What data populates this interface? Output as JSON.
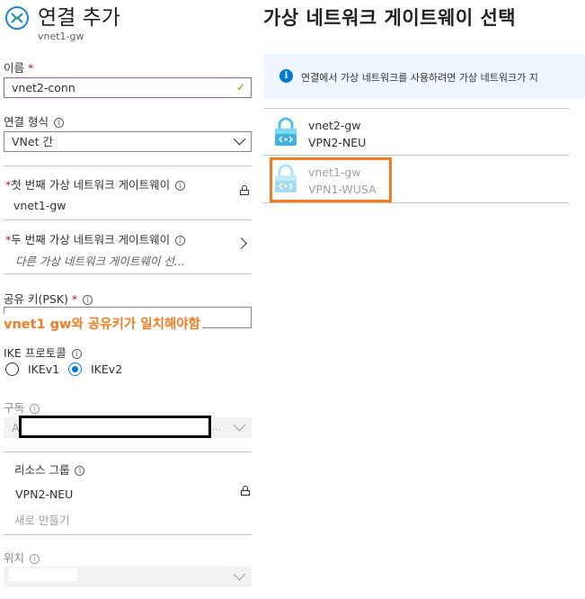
{
  "left_blade": {
    "title": "연결 추가",
    "subtitle": "vnet1-gw",
    "name": {
      "label": "이름",
      "required": "*",
      "value": "vnet2-conn",
      "valid": true
    },
    "connection_type": {
      "label": "연결 형식",
      "value": "VNet 간"
    },
    "first_gateway": {
      "required": "*",
      "label": "첫 번째 가상 네트워크 게이트웨이",
      "value": "vnet1-gw",
      "locked": true
    },
    "second_gateway": {
      "required": "*",
      "label": "두 번째 가상 네트워크 게이트웨이",
      "placeholder": "다른 가상 네트워크 게이트웨이 선..."
    },
    "shared_key": {
      "label": "공유 키(PSK)",
      "required": "*",
      "annotation": "vnet1 gw와 공유키가 일치해야함"
    },
    "ike": {
      "label": "IKE 프로토콜",
      "options": [
        "IKEv1",
        "IKEv2"
      ],
      "selected": "IKEv2"
    },
    "subscription": {
      "label": "구독",
      "value_partial": "A",
      "value_suffix": "..."
    },
    "resource_group": {
      "label": "리소스 그룹",
      "value": "VPN2-NEU",
      "create_new": "새로 만들기",
      "locked": true
    },
    "location": {
      "label": "위치"
    }
  },
  "right_blade": {
    "title": "가상 네트워크 게이트웨이 선택",
    "info_banner": "연결에서 가상 네트워크를 사용하려면 가상 네트워크가 지",
    "gateways": [
      {
        "name": "vnet2-gw",
        "resource_group": "VPN2-NEU",
        "enabled": true
      },
      {
        "name": "vnet1-gw",
        "resource_group": "VPN1-WUSA",
        "enabled": false
      }
    ]
  },
  "colors": {
    "accent": "#0078d4",
    "annotation": "#f47b20",
    "required": "#a4262c",
    "valid": "#57a300"
  }
}
